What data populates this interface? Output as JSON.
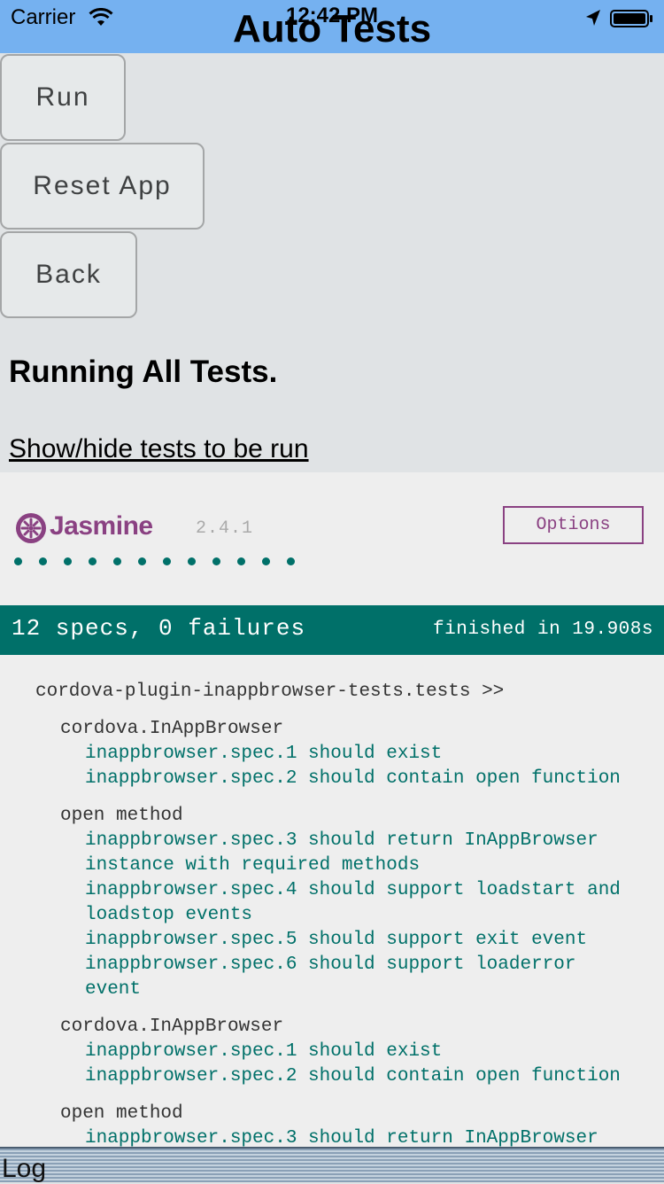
{
  "status_bar": {
    "carrier": "Carrier",
    "time": "12:42 PM",
    "icons": [
      "wifi-icon",
      "location-arrow-icon",
      "battery-icon"
    ]
  },
  "header": {
    "title": "Auto Tests",
    "bg_color": "#75b1f0"
  },
  "buttons": {
    "run": "Run",
    "reset": "Reset App",
    "back": "Back"
  },
  "status_text": "Running All Tests.",
  "toggle_link": "Show/hide tests to be run",
  "jasmine": {
    "brand": "Jasmine",
    "version": "2.4.1",
    "options_label": "Options",
    "passed_dots": 12,
    "accent_color": "#8a4182",
    "pass_color": "#007069",
    "summary": {
      "specs": "12 specs, 0 failures",
      "finished": "finished in 19.908s"
    },
    "results": {
      "root_suite": "cordova-plugin-inappbrowser-tests.tests >>",
      "lines": [
        {
          "kind": "suite",
          "text": "cordova.InAppBrowser"
        },
        {
          "kind": "spec",
          "text": "inappbrowser.spec.1 should exist"
        },
        {
          "kind": "spec",
          "text": "inappbrowser.spec.2 should contain open function"
        },
        {
          "kind": "suite",
          "text": "open method"
        },
        {
          "kind": "spec",
          "text": "inappbrowser.spec.3 should return InAppBrowser"
        },
        {
          "kind": "spec",
          "text": "instance with required methods"
        },
        {
          "kind": "spec",
          "text": "inappbrowser.spec.4 should support loadstart and"
        },
        {
          "kind": "spec",
          "text": "loadstop events"
        },
        {
          "kind": "spec",
          "text": "inappbrowser.spec.5 should support exit event"
        },
        {
          "kind": "spec",
          "text": "inappbrowser.spec.6 should support loaderror"
        },
        {
          "kind": "spec",
          "text": "event"
        },
        {
          "kind": "suite",
          "text": "cordova.InAppBrowser"
        },
        {
          "kind": "spec",
          "text": "inappbrowser.spec.1 should exist"
        },
        {
          "kind": "spec",
          "text": "inappbrowser.spec.2 should contain open function"
        },
        {
          "kind": "suite",
          "text": "open method"
        },
        {
          "kind": "spec",
          "text": "inappbrowser.spec.3 should return InAppBrowser"
        }
      ]
    }
  },
  "log": {
    "label": "Log"
  }
}
